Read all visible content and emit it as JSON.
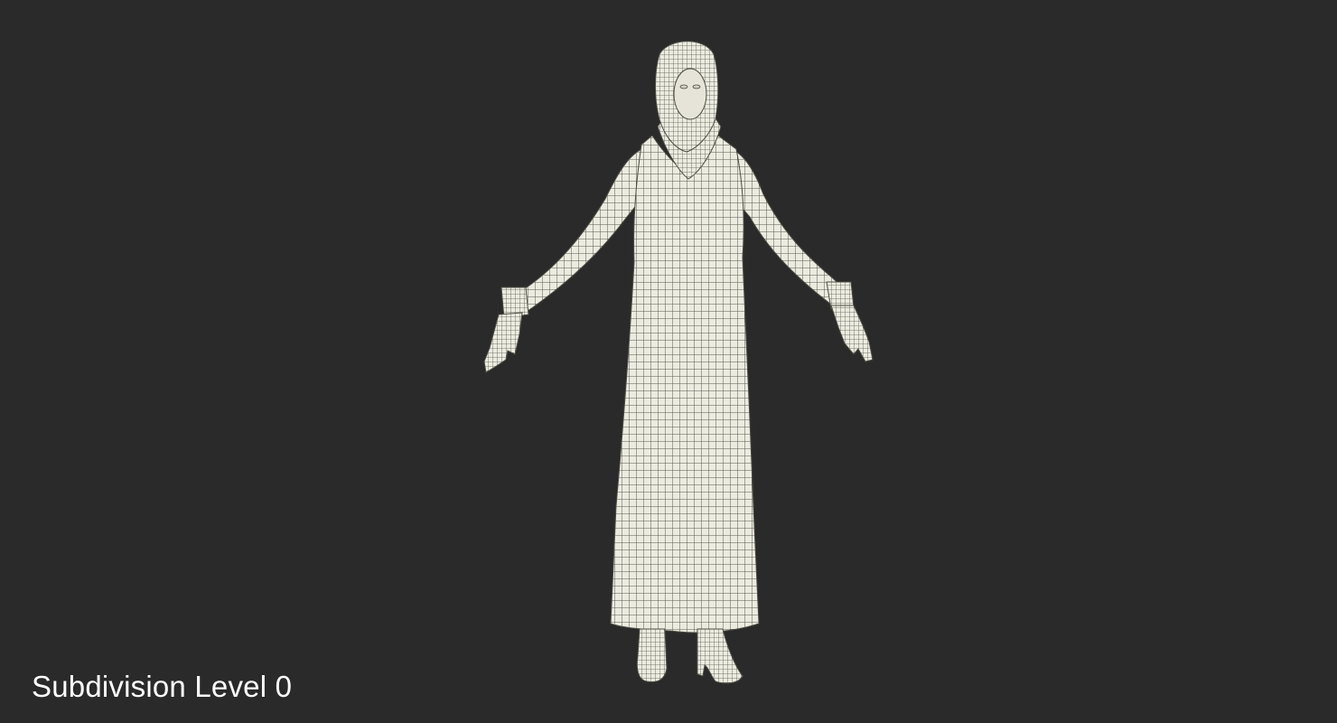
{
  "viewport": {
    "background": "#2a2a2a",
    "mesh_fill": "#ecebe0",
    "mesh_line": "#4d4d44"
  },
  "caption": {
    "text": "Subdivision Level 0"
  }
}
